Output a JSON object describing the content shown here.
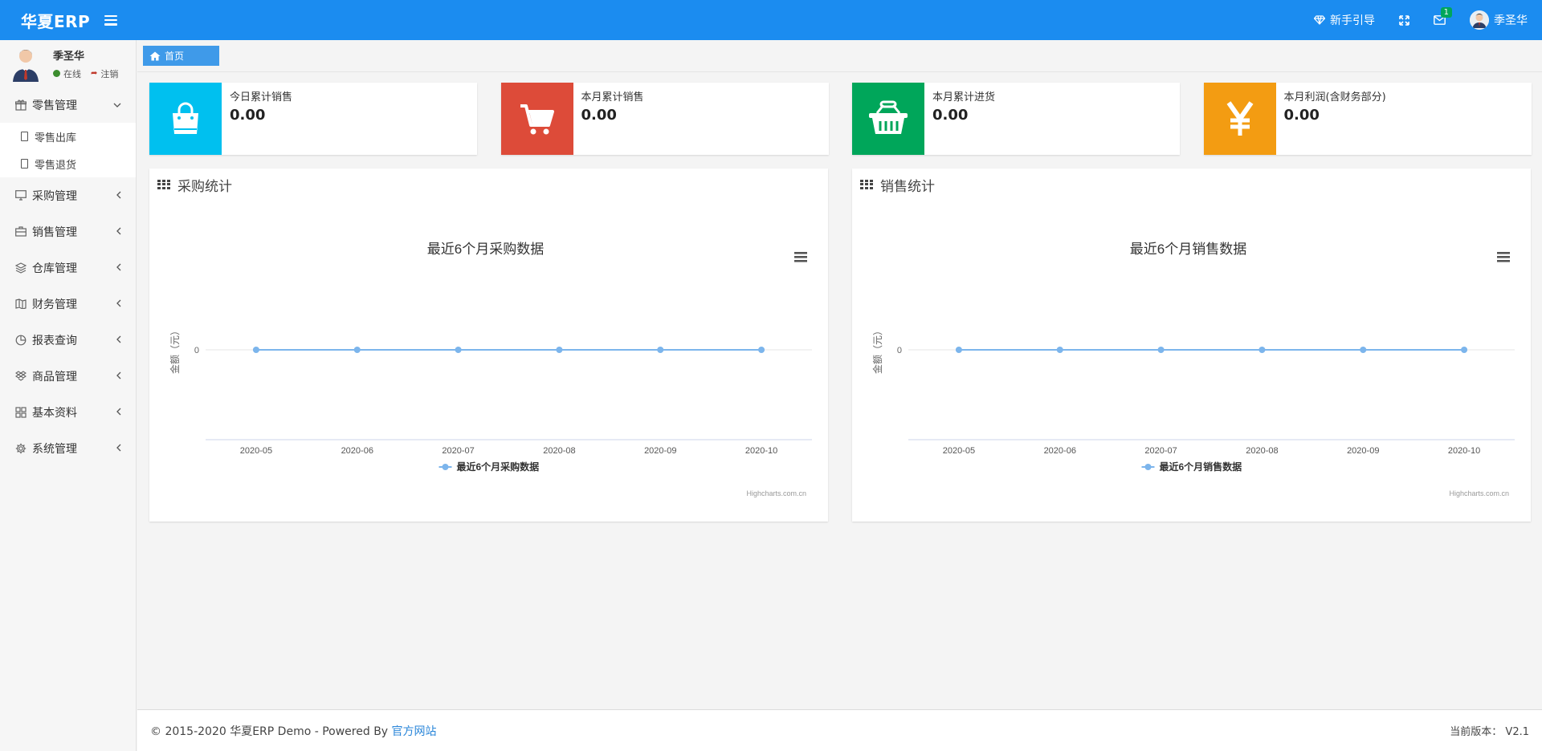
{
  "topbar": {
    "brand": "华夏ERP",
    "guide_label": "新手引导",
    "mail_badge": "1",
    "user_name": "季圣华",
    "accent": "#1b8cf0"
  },
  "sidebar": {
    "user_name": "季圣华",
    "status_online": "在线",
    "logout": "注销",
    "menu": [
      {
        "label": "零售管理",
        "icon": "gift-icon",
        "expanded": true,
        "children": [
          {
            "label": "零售出库"
          },
          {
            "label": "零售退货"
          }
        ]
      },
      {
        "label": "采购管理",
        "icon": "desktop-icon"
      },
      {
        "label": "销售管理",
        "icon": "briefcase-icon"
      },
      {
        "label": "仓库管理",
        "icon": "layers-icon"
      },
      {
        "label": "财务管理",
        "icon": "map-icon"
      },
      {
        "label": "报表查询",
        "icon": "pie-chart-icon"
      },
      {
        "label": "商品管理",
        "icon": "dropbox-icon"
      },
      {
        "label": "基本资料",
        "icon": "grid-icon"
      },
      {
        "label": "系统管理",
        "icon": "gear-icon"
      }
    ]
  },
  "breadcrumb": {
    "home": "首页"
  },
  "stats": [
    {
      "label": "今日累计销售",
      "value": "0.00",
      "color": "#00c0ef",
      "icon": "shopping-bag-icon"
    },
    {
      "label": "本月累计销售",
      "value": "0.00",
      "color": "#dd4b39",
      "icon": "shopping-cart-icon"
    },
    {
      "label": "本月累计进货",
      "value": "0.00",
      "color": "#00a65a",
      "icon": "basket-icon"
    },
    {
      "label": "本月利润(含财务部分)",
      "value": "0.00",
      "color": "#f39c12",
      "icon": "yen-icon"
    }
  ],
  "panels": {
    "purchase": {
      "title": "采购统计"
    },
    "sales": {
      "title": "销售统计"
    }
  },
  "chart_data": [
    {
      "type": "line",
      "title": "最近6个月采购数据",
      "ylabel": "金额（元）",
      "xlabel": "",
      "categories": [
        "2020-05",
        "2020-06",
        "2020-07",
        "2020-08",
        "2020-09",
        "2020-10"
      ],
      "series": [
        {
          "name": "最近6个月采购数据",
          "values": [
            0,
            0,
            0,
            0,
            0,
            0
          ]
        }
      ],
      "yticks": [
        "0"
      ],
      "credits": "Highcharts.com.cn",
      "legend": "bottom-center",
      "color": "#7cb5ec"
    },
    {
      "type": "line",
      "title": "最近6个月销售数据",
      "ylabel": "金额（元）",
      "xlabel": "",
      "categories": [
        "2020-05",
        "2020-06",
        "2020-07",
        "2020-08",
        "2020-09",
        "2020-10"
      ],
      "series": [
        {
          "name": "最近6个月销售数据",
          "values": [
            0,
            0,
            0,
            0,
            0,
            0
          ]
        }
      ],
      "yticks": [
        "0"
      ],
      "credits": "Highcharts.com.cn",
      "legend": "bottom-center",
      "color": "#7cb5ec"
    }
  ],
  "footer": {
    "copyright": "© 2015-2020 华夏ERP Demo - Powered By",
    "link": "官方网站",
    "version_label": "当前版本：",
    "version": "V2.1"
  }
}
